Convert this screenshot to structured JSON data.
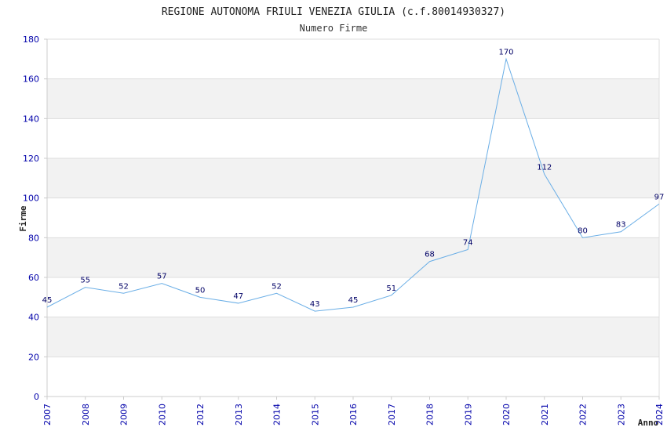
{
  "chart_data": {
    "type": "line",
    "title": "REGIONE AUTONOMA FRIULI VENEZIA GIULIA (c.f.80014930327)",
    "subtitle": "Numero Firme",
    "xlabel": "Anno",
    "ylabel": "Firme",
    "categories": [
      "2007",
      "2008",
      "2009",
      "2010",
      "2012",
      "2013",
      "2014",
      "2015",
      "2016",
      "2017",
      "2018",
      "2019",
      "2020",
      "2021",
      "2022",
      "2023",
      "2024"
    ],
    "values": [
      45,
      55,
      52,
      57,
      50,
      47,
      52,
      43,
      45,
      51,
      68,
      74,
      170,
      112,
      80,
      83,
      97
    ],
    "ylim": [
      0,
      180
    ],
    "yticks": [
      0,
      20,
      40,
      60,
      80,
      100,
      120,
      140,
      160,
      180
    ],
    "grid": true,
    "line_color": "#6aaee6",
    "band_color": "#f2f2f2"
  }
}
